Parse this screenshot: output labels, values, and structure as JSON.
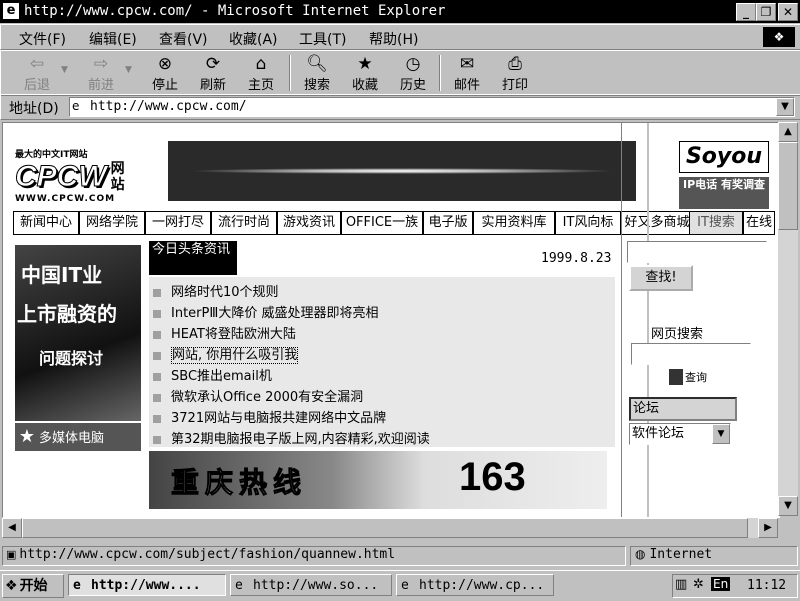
{
  "window": {
    "title": "http://www.cpcw.com/ - Microsoft Internet Explorer"
  },
  "menu": [
    "文件(F)",
    "编辑(E)",
    "查看(V)",
    "收藏(A)",
    "工具(T)",
    "帮助(H)"
  ],
  "toolbar": {
    "back": "后退",
    "forward": "前进",
    "stop": "停止",
    "refresh": "刷新",
    "home": "主页",
    "search": "搜索",
    "favorites": "收藏",
    "history": "历史",
    "mail": "邮件",
    "print": "打印"
  },
  "address": {
    "label": "地址(D)",
    "value": "http://www.cpcw.com/"
  },
  "site": {
    "logo_tagline": "最大的中文IT网站",
    "logo_name": "CPCW",
    "logo_cn": "网站",
    "logo_url": "WWW.CPCW.COM",
    "top_right_ad": "Soyou",
    "top_right_sub": "IP电话 有奖调查",
    "nav": [
      "新闻中心",
      "网络学院",
      "一网打尽",
      "流行时尚",
      "游戏资讯",
      "OFFICE一族",
      "电子版",
      "实用资料库",
      "IT风向标",
      "好又多商城",
      "IT搜索",
      "在线"
    ],
    "left_ad_lines": [
      "中国IT业",
      "上市融资的",
      "问题探讨"
    ],
    "left_ad_bottom": "多媒体电脑",
    "headlines_label": "今日头条资讯",
    "date": "1999.8.23",
    "headlines": [
      "网络时代10个规则",
      "InterPⅢ大降价 威盛处理器即将亮相",
      "HEAT将登陆欧洲大陆",
      "网站, 你用什么吸引我",
      "SBC推出email机",
      "微软承认Office 2000有安全漏洞",
      "3721网站与电脑报共建网络中文品牌",
      "第32期电脑报电子版上网,内容精彩,欢迎阅读"
    ],
    "banner_text": "重庆热线",
    "banner_num": "163",
    "search_button": "查找!",
    "web_search_label": "网页搜索",
    "search_go": "查询",
    "forum_label": "论坛",
    "forum_select": "软件论坛"
  },
  "status": {
    "url": "http://www.cpcw.com/subject/fashion/quannew.html",
    "zone": "Internet"
  },
  "taskbar": {
    "start": "开始",
    "tasks": [
      "http://www....",
      "http://www.so...",
      "http://www.cp..."
    ],
    "ime": "En",
    "time": "11:12"
  }
}
